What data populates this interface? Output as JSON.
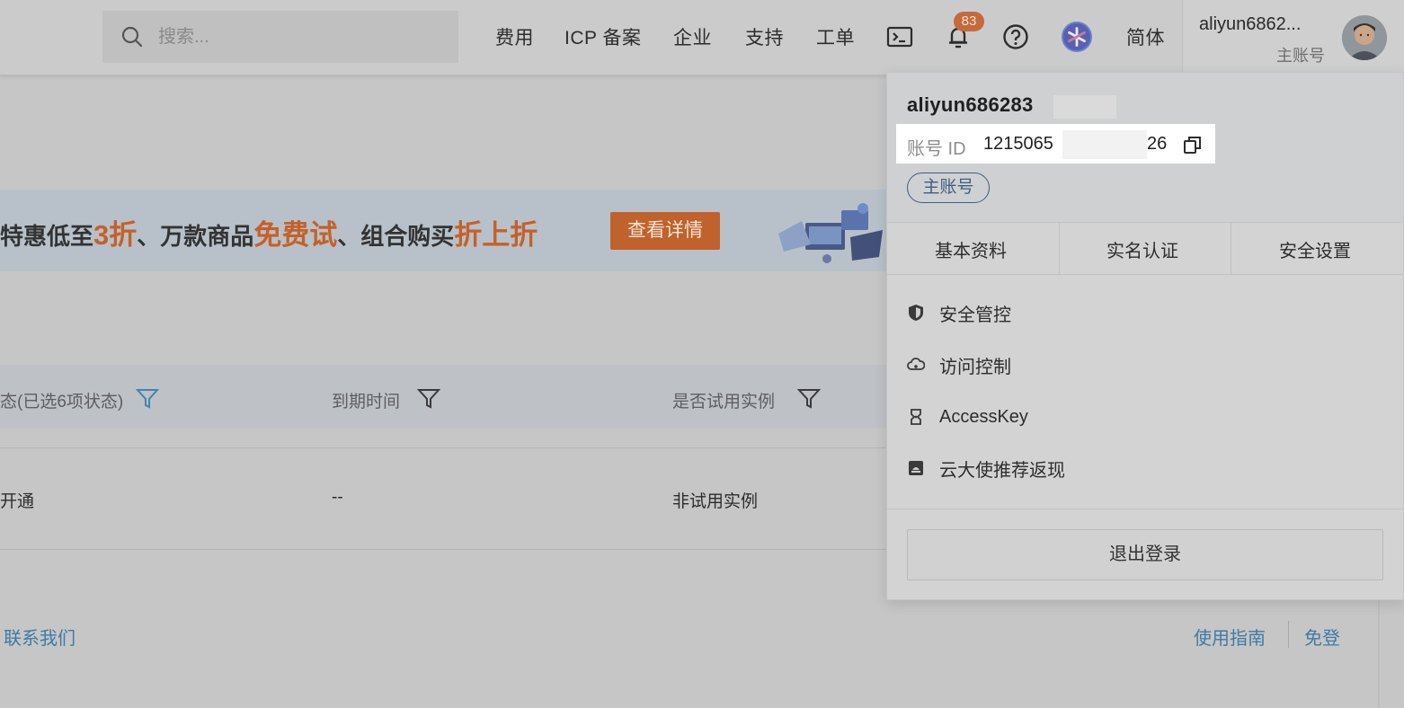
{
  "header": {
    "search_placeholder": "搜索...",
    "nav": [
      "费用",
      "ICP 备案",
      "企业",
      "支持",
      "工单"
    ],
    "notification_count": "83",
    "language": "简体",
    "account_name": "aliyun6862...",
    "account_type": "主账号"
  },
  "banner": {
    "text_1": "特惠低至",
    "hl_1": "3折",
    "text_2": "、万款商品",
    "hl_2": "免费试",
    "text_3": "、组合购买",
    "hl_3": "折上折",
    "button": "查看详情"
  },
  "table": {
    "headers": [
      "态(已选6项状态)",
      "到期时间",
      "是否试用实例"
    ],
    "row": [
      "开通",
      "--",
      "非试用实例"
    ]
  },
  "footer_links": {
    "contact": "联系我们",
    "guide": "使用指南",
    "free": "免登"
  },
  "dropdown": {
    "username": "aliyun686283",
    "id_label": "账号 ID",
    "id_prefix": "1215065",
    "id_suffix": "26",
    "account_pill": "主账号",
    "tabs": [
      "基本资料",
      "实名认证",
      "安全设置"
    ],
    "menu": [
      {
        "label": "安全管控",
        "icon": "shield-icon"
      },
      {
        "label": "访问控制",
        "icon": "cloud-icon"
      },
      {
        "label": "AccessKey",
        "icon": "key-icon"
      },
      {
        "label": "云大使推荐返现",
        "icon": "ambassador-icon"
      }
    ],
    "logout": "退出登录"
  },
  "colors": {
    "accent_orange": "#c0622c",
    "link_blue": "#3f7aa6",
    "pill_blue": "#3d5e86"
  }
}
